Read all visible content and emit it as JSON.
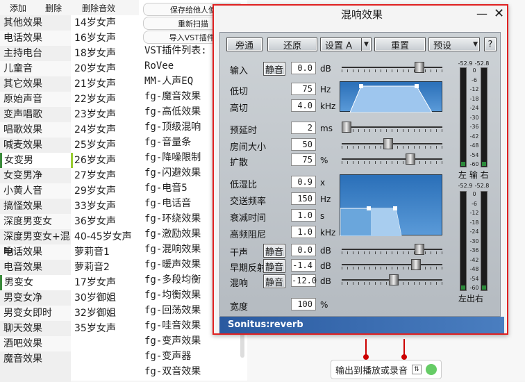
{
  "toolbar": {
    "add": "添加",
    "delete": "删除",
    "delete_effect": "删除音效"
  },
  "presets_col1": [
    "其他效果",
    "电话效果",
    "主持电台",
    "儿童音",
    "其它效果",
    "原始声音",
    "变声唱歌",
    "唱歌效果",
    "喊麦效果",
    "女变男",
    "女变男净",
    "小黄人音",
    "搞怪效果",
    "深度男变女",
    "深度男变女+混响",
    "电话效果",
    "电音效果",
    "男变女",
    "男变女净",
    "男变女即时",
    "聊天效果",
    "酒吧效果",
    "魔音效果"
  ],
  "presets_col2": [
    "14岁女声",
    "16岁女声",
    "18岁女声",
    "20岁女声",
    "21岁女声",
    "22岁女声",
    "23岁女声",
    "24岁女声",
    "25岁女声",
    "26岁女声",
    "27岁女声",
    "29岁女声",
    "33岁女声",
    "36岁女声",
    "40-45岁女声",
    "萝莉音1",
    "萝莉音2",
    "17岁女声",
    "30岁御姐",
    "32岁御姐",
    "35岁女声"
  ],
  "actions": {
    "save": "保存给他人使",
    "rescan": "重新扫描",
    "import": "导入VST插件."
  },
  "plugins_title": "VST插件列表:",
  "plugins": [
    "RoVee",
    "MM-人声EQ",
    "fg-魔音效果",
    "fg-高低效果",
    "fg-顶级混响",
    "fg-音量条",
    "fg-降噪限制",
    "fg-闪避效果",
    "fg-电音5",
    "fg-电话音",
    "fg-环绕效果",
    "fg-激励效果",
    "fg-混响效果",
    "fg-暖声效果",
    "fg-多段均衡",
    "fg-均衡效果",
    "fg-回荡效果",
    "fg-哇音效果",
    "fg-变声效果",
    "fg-变声器",
    "fg-双音效果"
  ],
  "window": {
    "title": "混响效果",
    "min": "—",
    "close": "✕"
  },
  "top_buttons": {
    "bypass": "旁通",
    "restore": "还原",
    "setting": "设置 A",
    "reset": "重置",
    "preset": "预设",
    "help": "?"
  },
  "params": {
    "input": {
      "label": "输入",
      "btn": "静音",
      "value": "0.0",
      "unit": "dB"
    },
    "lowcut": {
      "label": "低切",
      "value": "75",
      "unit": "Hz"
    },
    "highcut": {
      "label": "高切",
      "value": "4.0",
      "unit": "kHz"
    },
    "predelay": {
      "label": "预延时",
      "value": "2",
      "unit": "ms"
    },
    "roomsize": {
      "label": "房间大小",
      "value": "50",
      "unit": ""
    },
    "spread": {
      "label": "扩散",
      "value": "75",
      "unit": "%"
    },
    "lowmix": {
      "label": "低湿比",
      "value": "0.9",
      "unit": "x"
    },
    "crossover": {
      "label": "交送频率",
      "value": "150",
      "unit": "Hz"
    },
    "decay": {
      "label": "衰减时间",
      "value": "1.0",
      "unit": "s"
    },
    "hfdamp": {
      "label": "高频阻尼",
      "value": "1.0",
      "unit": "kHz"
    },
    "dry": {
      "label": "干声",
      "btn": "静音",
      "value": "0.0",
      "unit": "dB"
    },
    "early": {
      "label": "早期反射",
      "btn": "静音",
      "value": "-1.4",
      "unit": "dB"
    },
    "reverb": {
      "label": "混响",
      "btn": "静音",
      "value": "-12.0",
      "unit": "dB"
    },
    "width": {
      "label": "宽度",
      "value": "100",
      "unit": "%"
    }
  },
  "meters": {
    "in_l": "-52.9",
    "in_r": "-52.8",
    "in_label": "左 输 右",
    "out_l": "-52.9",
    "out_r": "-52.8",
    "out_label": "左出右",
    "scale": [
      "0",
      "-6",
      "-12",
      "-18",
      "-24",
      "-30",
      "-36",
      "-42",
      "-48",
      "-54",
      "-60"
    ]
  },
  "plugin_name": "Sonitus:reverb",
  "bottom": {
    "output": "输出到播放或录音"
  }
}
